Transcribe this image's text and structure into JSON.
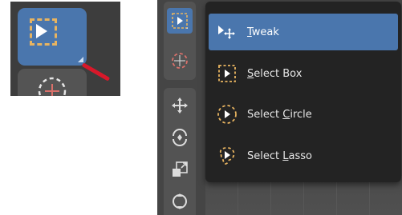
{
  "colors": {
    "accent": "#4a76ad",
    "menu_bg": "#232323",
    "toolbar_bg": "#535353",
    "dash_orange": "#e8b460",
    "circle_red": "#d9706a",
    "annotation_red": "#d8182a"
  },
  "left_panel": {
    "active_tool_icon": "select-box-icon",
    "next_tool_icon": "select-circle-icon"
  },
  "toolbar": {
    "buttons": [
      {
        "icon": "select-box-icon",
        "active": true
      },
      {
        "icon": "cursor-icon",
        "active": false
      },
      {
        "icon": "move-icon",
        "active": false
      },
      {
        "icon": "rotate-icon",
        "active": false
      },
      {
        "icon": "scale-icon",
        "active": false
      },
      {
        "icon": "transform-icon",
        "active": false
      }
    ]
  },
  "menu": {
    "items": [
      {
        "label_pre": "",
        "label_ul": "T",
        "label_post": "weak",
        "icon": "tweak-icon",
        "highlighted": true
      },
      {
        "label_pre": "",
        "label_ul": "S",
        "label_post": "elect Box",
        "icon": "select-box-icon",
        "highlighted": false
      },
      {
        "label_pre": "Select ",
        "label_ul": "C",
        "label_post": "ircle",
        "icon": "select-circle-icon",
        "highlighted": false
      },
      {
        "label_pre": "Select ",
        "label_ul": "L",
        "label_post": "asso",
        "icon": "select-lasso-icon",
        "highlighted": false
      }
    ]
  }
}
